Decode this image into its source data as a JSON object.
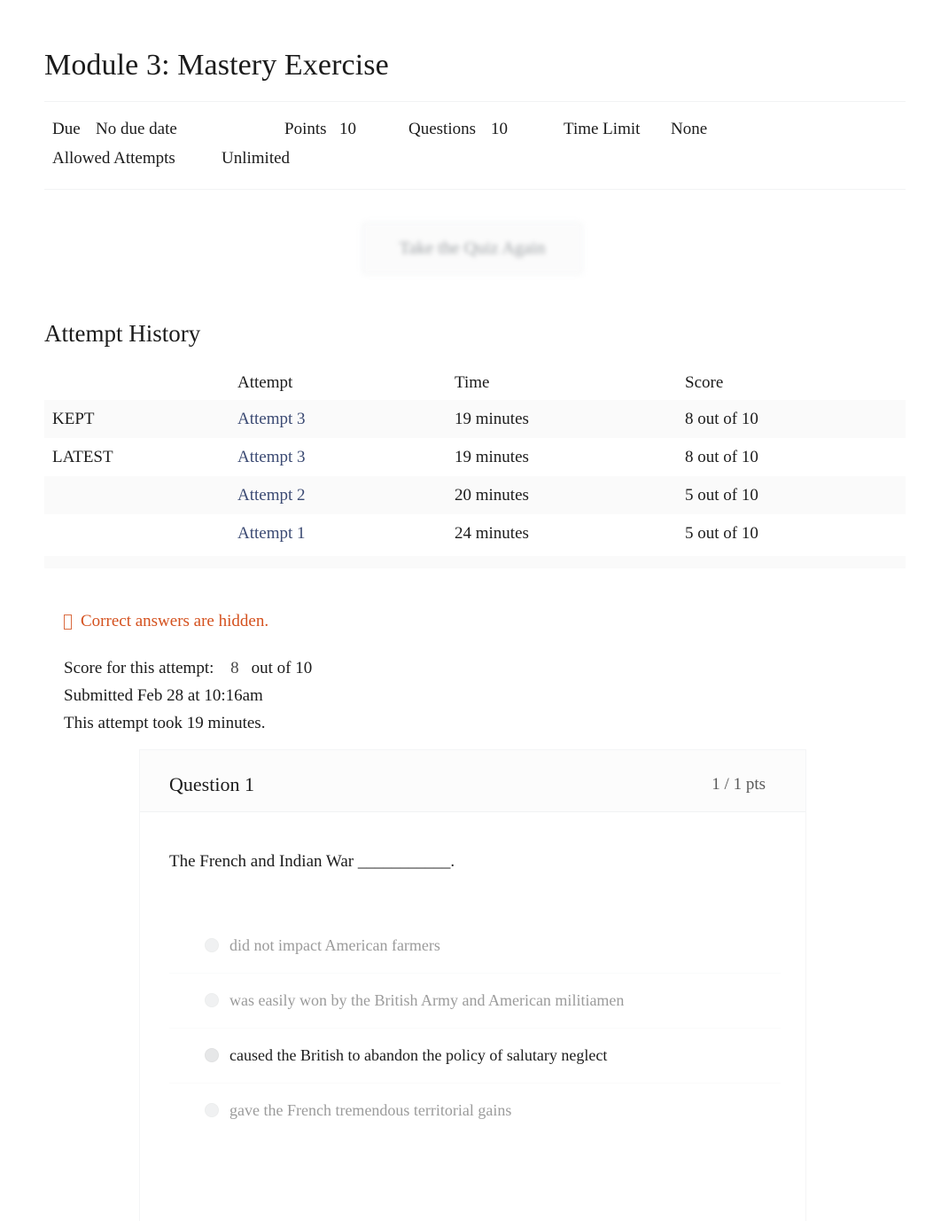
{
  "quiz": {
    "title": "Module 3: Mastery Exercise",
    "info": {
      "due_label": "Due",
      "due_value": "No due date",
      "points_label": "Points",
      "points_value": "10",
      "questions_label": "Questions",
      "questions_value": "10",
      "time_limit_label": "Time Limit",
      "time_limit_value": "None",
      "allowed_attempts_label": "Allowed Attempts",
      "allowed_attempts_value": "Unlimited"
    },
    "retake_button_label": "Take the Quiz Again"
  },
  "attempt_history": {
    "heading": "Attempt History",
    "columns": [
      "",
      "Attempt",
      "Time",
      "Score"
    ],
    "rows": [
      {
        "tag": "KEPT",
        "attempt": "Attempt 3",
        "time": "19 minutes",
        "score": "8 out of 10"
      },
      {
        "tag": "LATEST",
        "attempt": "Attempt 3",
        "time": "19 minutes",
        "score": "8 out of 10"
      },
      {
        "tag": "",
        "attempt": "Attempt 2",
        "time": "20 minutes",
        "score": "5 out of 10"
      },
      {
        "tag": "",
        "attempt": "Attempt 1",
        "time": "24 minutes",
        "score": "5 out of 10"
      }
    ]
  },
  "notice": {
    "icon": "missing-glyph-icon",
    "text": "Correct answers are hidden.",
    "color": "#d4511e"
  },
  "summary": {
    "score_label": "Score for this attempt:",
    "score_value": "8",
    "score_suffix": "out of 10",
    "submitted": "Submitted Feb 28 at 10:16am",
    "duration": "This attempt took 19 minutes."
  },
  "question": {
    "name": "Question 1",
    "points": "1 / 1 pts",
    "text": "The French and Indian War ___________.",
    "answers": [
      {
        "label": "did not impact American farmers",
        "selected": false
      },
      {
        "label": "was easily won by the British Army and American militiamen",
        "selected": false
      },
      {
        "label": "caused the British to abandon the policy of salutary neglect",
        "selected": true
      },
      {
        "label": "gave the French tremendous territorial gains",
        "selected": false
      }
    ]
  },
  "colors": {
    "link": "#3b4a73",
    "warning": "#d4511e",
    "text": "#1b1b1b",
    "muted": "#9b9b9b"
  }
}
